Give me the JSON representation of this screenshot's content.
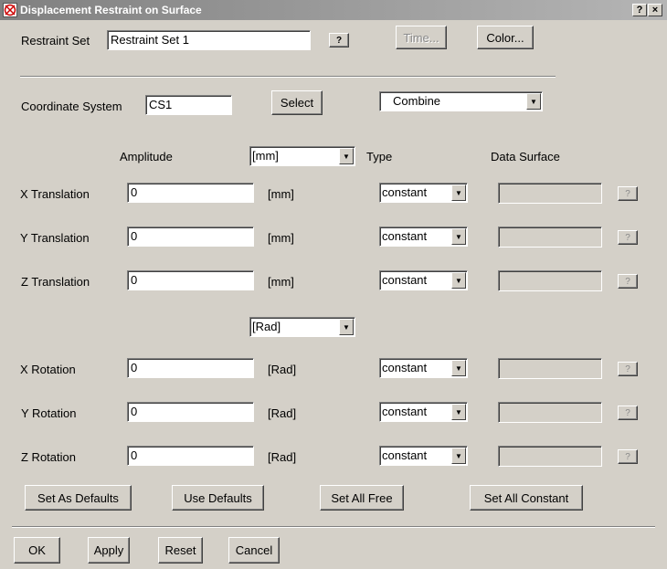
{
  "window": {
    "title": "Displacement Restraint on Surface",
    "help_btn": "?",
    "close_btn": "×"
  },
  "restraint": {
    "label": "Restraint Set",
    "value": "Restraint Set 1",
    "help": "?",
    "time_btn": "Time...",
    "color_btn": "Color..."
  },
  "coords": {
    "label": "Coordinate System",
    "value": "CS1",
    "select_btn": "Select",
    "mode": "Combine"
  },
  "headers": {
    "amplitude": "Amplitude",
    "type": "Type",
    "data_surface": "Data Surface"
  },
  "translation_unit": "[mm]",
  "rotation_unit": "[Rad]",
  "rows": [
    {
      "label": "X Translation",
      "value": "0",
      "unit": "[mm]",
      "type": "constant",
      "help": "?"
    },
    {
      "label": "Y Translation",
      "value": "0",
      "unit": "[mm]",
      "type": "constant",
      "help": "?"
    },
    {
      "label": "Z Translation",
      "value": "0",
      "unit": "[mm]",
      "type": "constant",
      "help": "?"
    },
    {
      "label": "X Rotation",
      "value": "0",
      "unit": "[Rad]",
      "type": "constant",
      "help": "?"
    },
    {
      "label": "Y Rotation",
      "value": "0",
      "unit": "[Rad]",
      "type": "constant",
      "help": "?"
    },
    {
      "label": "Z Rotation",
      "value": "0",
      "unit": "[Rad]",
      "type": "constant",
      "help": "?"
    }
  ],
  "actions": {
    "set_defaults": "Set As Defaults",
    "use_defaults": "Use Defaults",
    "set_all_free": "Set All Free",
    "set_all_constant": "Set All Constant"
  },
  "footer": {
    "ok": "OK",
    "apply": "Apply",
    "reset": "Reset",
    "cancel": "Cancel"
  },
  "icons": {
    "app": "crossed-circle-icon",
    "dropdown": "chevron-down-icon"
  }
}
